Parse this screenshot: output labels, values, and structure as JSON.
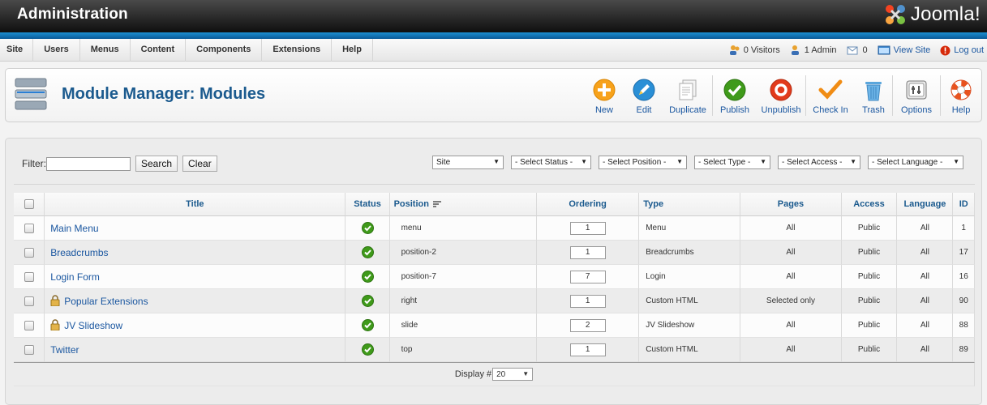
{
  "header": {
    "title": "Administration",
    "logo_text": "Joomla!"
  },
  "menubar": {
    "items": [
      "Site",
      "Users",
      "Menus",
      "Content",
      "Components",
      "Extensions",
      "Help"
    ],
    "status": {
      "visitors": "0 Visitors",
      "admins": "1 Admin",
      "messages": "0",
      "view_site": "View Site",
      "logout": "Log out"
    }
  },
  "toolbar": {
    "page_title": "Module Manager: Modules",
    "buttons": {
      "new": "New",
      "edit": "Edit",
      "duplicate": "Duplicate",
      "publish": "Publish",
      "unpublish": "Unpublish",
      "checkin": "Check In",
      "trash": "Trash",
      "options": "Options",
      "help": "Help"
    }
  },
  "filter": {
    "label": "Filter:",
    "value": "",
    "search_label": "Search",
    "clear_label": "Clear",
    "selects": {
      "client": "Site",
      "status": "- Select Status -",
      "position": "- Select Position -",
      "type": "- Select Type -",
      "access": "- Select Access -",
      "language": "- Select Language -"
    }
  },
  "table": {
    "columns": {
      "title": "Title",
      "status": "Status",
      "position": "Position",
      "ordering": "Ordering",
      "type": "Type",
      "pages": "Pages",
      "access": "Access",
      "language": "Language",
      "id": "ID"
    },
    "rows": [
      {
        "title": "Main Menu",
        "locked": false,
        "published": true,
        "position": "menu",
        "ordering": "1",
        "type": "Menu",
        "pages": "All",
        "access": "Public",
        "language": "All",
        "id": "1"
      },
      {
        "title": "Breadcrumbs",
        "locked": false,
        "published": true,
        "position": "position-2",
        "ordering": "1",
        "type": "Breadcrumbs",
        "pages": "All",
        "access": "Public",
        "language": "All",
        "id": "17"
      },
      {
        "title": "Login Form",
        "locked": false,
        "published": true,
        "position": "position-7",
        "ordering": "7",
        "type": "Login",
        "pages": "All",
        "access": "Public",
        "language": "All",
        "id": "16"
      },
      {
        "title": "Popular Extensions",
        "locked": true,
        "published": true,
        "position": "right",
        "ordering": "1",
        "type": "Custom HTML",
        "pages": "Selected only",
        "access": "Public",
        "language": "All",
        "id": "90"
      },
      {
        "title": "JV Slideshow",
        "locked": true,
        "published": true,
        "position": "slide",
        "ordering": "2",
        "type": "JV Slideshow",
        "pages": "All",
        "access": "Public",
        "language": "All",
        "id": "88"
      },
      {
        "title": "Twitter",
        "locked": false,
        "published": true,
        "position": "top",
        "ordering": "1",
        "type": "Custom HTML",
        "pages": "All",
        "access": "Public",
        "language": "All",
        "id": "89"
      }
    ],
    "footer": {
      "display_label": "Display #",
      "display_value": "20"
    }
  },
  "colors": {
    "header_bg": "#1a1a1a",
    "blue_bar": "#0a6cb5",
    "title_blue": "#1b5a8e",
    "link_blue": "#1b57a0",
    "published_green": "#3f9a1a"
  }
}
